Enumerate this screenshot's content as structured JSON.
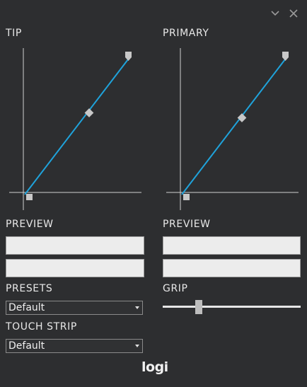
{
  "window": {
    "minimize_icon": "chevron-down-icon",
    "close_icon": "close-icon"
  },
  "tip": {
    "label": "TIP",
    "curve": {
      "handles": [
        "start",
        "mid",
        "end"
      ]
    }
  },
  "primary": {
    "label": "PRIMARY",
    "curve": {
      "handles": [
        "start",
        "mid",
        "end"
      ]
    }
  },
  "preview_left": {
    "label": "PREVIEW"
  },
  "preview_right": {
    "label": "PREVIEW"
  },
  "presets": {
    "label": "PRESETS",
    "selected": "Default"
  },
  "grip": {
    "label": "GRIP",
    "value_fraction": 0.26
  },
  "touch_strip": {
    "label": "TOUCH STRIP",
    "selected": "Default"
  },
  "brand": {
    "logo_text": "logi"
  },
  "colors": {
    "background": "#2d2e30",
    "curve": "#1fa3db",
    "handle": "#c8c8c8"
  }
}
